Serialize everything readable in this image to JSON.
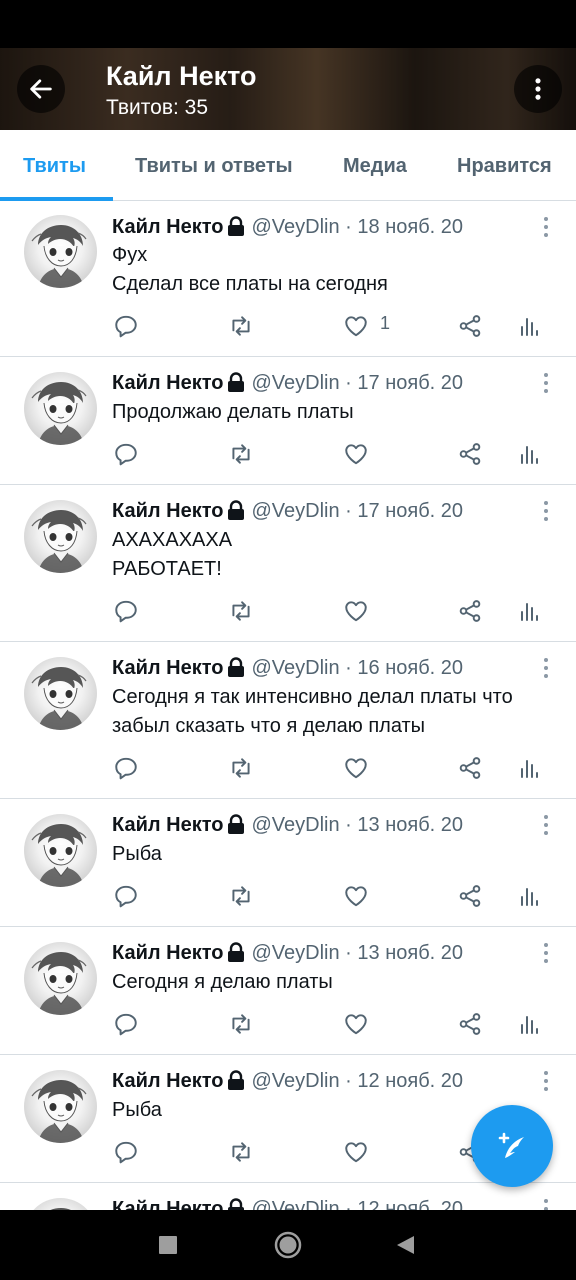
{
  "header": {
    "title": "Кайл Некто",
    "subtitle": "Твитов: 35",
    "back_icon": "arrow-left-icon",
    "more_icon": "more-vertical-icon"
  },
  "tabs": [
    {
      "label": "Твиты",
      "active": true
    },
    {
      "label": "Твиты и ответы",
      "active": false
    },
    {
      "label": "Медиа",
      "active": false
    },
    {
      "label": "Нравится",
      "active": false
    }
  ],
  "tweets": [
    {
      "name": "Кайл Некто",
      "handle": "@VeyDlin",
      "dot": "·",
      "date": "18 нояб. 20",
      "text": [
        "Фух",
        "Сделал все платы на сегодня"
      ],
      "likes": "1"
    },
    {
      "name": "Кайл Некто",
      "handle": "@VeyDlin",
      "dot": "·",
      "date": "17 нояб. 20",
      "text": [
        "Продолжаю делать платы"
      ],
      "likes": ""
    },
    {
      "name": "Кайл Некто",
      "handle": "@VeyDlin",
      "dot": "·",
      "date": "17 нояб. 20",
      "text": [
        "АХАХАХАХА",
        "РАБОТАЕТ!"
      ],
      "likes": ""
    },
    {
      "name": "Кайл Некто",
      "handle": "@VeyDlin",
      "dot": "·",
      "date": "16 нояб. 20",
      "text": [
        "Сегодня я так интенсивно делал платы что",
        "забыл сказать что я делаю платы"
      ],
      "likes": ""
    },
    {
      "name": "Кайл Некто",
      "handle": "@VeyDlin",
      "dot": "·",
      "date": "13 нояб. 20",
      "text": [
        "Рыба"
      ],
      "likes": ""
    },
    {
      "name": "Кайл Некто",
      "handle": "@VeyDlin",
      "dot": "·",
      "date": "13 нояб. 20",
      "text": [
        "Сегодня я делаю платы"
      ],
      "likes": ""
    },
    {
      "name": "Кайл Некто",
      "handle": "@VeyDlin",
      "dot": "·",
      "date": "12 нояб. 20",
      "text": [
        "Рыба"
      ],
      "likes": ""
    },
    {
      "name": "Кайл Некто",
      "handle": "@VeyDlin",
      "dot": "·",
      "date": "12 нояб. 20",
      "text": [],
      "likes": ""
    }
  ],
  "action_icons": [
    "reply-icon",
    "retweet-icon",
    "like-icon",
    "share-icon",
    "analytics-icon"
  ],
  "fab_icon": "compose-tweet-icon",
  "nav_icons": [
    "recents-icon",
    "home-icon",
    "back-icon"
  ],
  "colors": {
    "accent": "#1d9bf0",
    "secondary_text": "#536471",
    "divider": "#d7dde2"
  }
}
